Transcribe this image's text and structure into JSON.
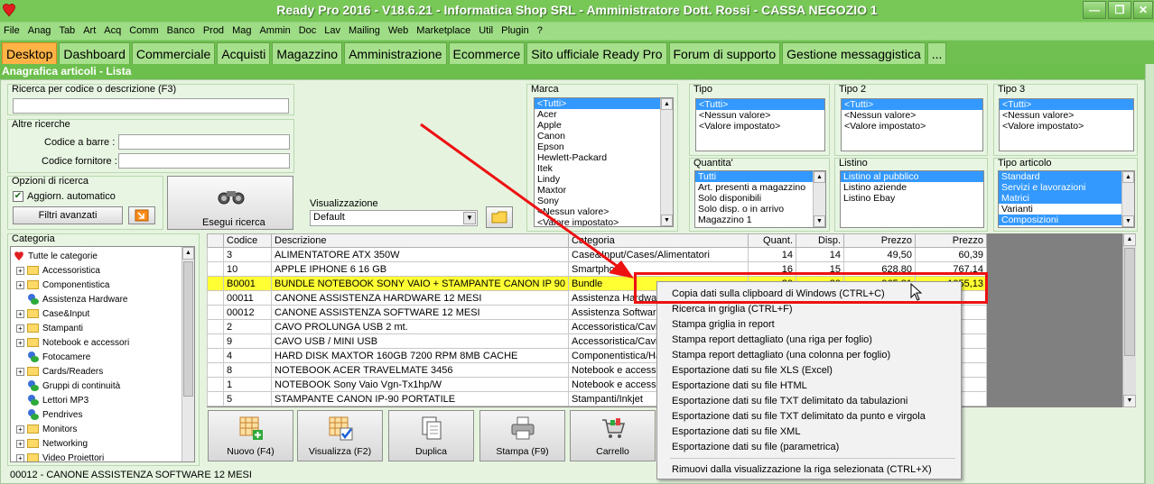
{
  "window": {
    "title": "Ready Pro 2016 - V18.6.21 - Informatica Shop SRL - Amministratore Dott. Rossi - CASSA NEGOZIO 1"
  },
  "menu": [
    "File",
    "Anag",
    "Tab",
    "Art",
    "Acq",
    "Comm",
    "Banco",
    "Prod",
    "Mag",
    "Ammin",
    "Doc",
    "Lav",
    "Mailing",
    "Web",
    "Marketplace",
    "Util",
    "Plugin",
    "?"
  ],
  "tabs": [
    "Desktop",
    "Dashboard",
    "Commerciale",
    "Acquisti",
    "Magazzino",
    "Amministrazione",
    "Ecommerce",
    "Sito ufficiale Ready Pro",
    "Forum di supporto",
    "Gestione messaggistica",
    "..."
  ],
  "section_title": "Anagrafica articoli  - Lista",
  "search": {
    "title": "Ricerca per codice o descrizione (F3)",
    "other_title": "Altre ricerche",
    "barcode_label": "Codice a barre :",
    "supplier_label": "Codice fornitore :",
    "options_title": "Opzioni di ricerca",
    "auto_update_label": "Aggiorn. automatico",
    "advanced_filters": "Filtri avanzati",
    "search_button": "Esegui ricerca",
    "view_label": "Visualizzazione",
    "view_value": "Default"
  },
  "filters": {
    "marca": {
      "title": "Marca",
      "items": [
        "<Tutti>",
        "Acer",
        "Apple",
        "Canon",
        "Epson",
        "Hewlett-Packard",
        "Itek",
        "Lindy",
        "Maxtor",
        "Sony",
        "<Nessun valore>",
        "<Valore impostato>"
      ]
    },
    "tipo": {
      "title": "Tipo",
      "items": [
        "<Tutti>",
        "<Nessun valore>",
        "<Valore impostato>"
      ]
    },
    "tipo2": {
      "title": "Tipo 2",
      "items": [
        "<Tutti>",
        "<Nessun valore>",
        "<Valore impostato>"
      ]
    },
    "tipo3": {
      "title": "Tipo 3",
      "items": [
        "<Tutti>",
        "<Nessun valore>",
        "<Valore impostato>"
      ]
    },
    "quantita": {
      "title": "Quantita'",
      "items": [
        "Tutti",
        "Art. presenti a magazzino",
        "Solo disponibili",
        "Solo disp. o in arrivo",
        "Magazzino 1"
      ]
    },
    "listino": {
      "title": "Listino",
      "items": [
        "Listino al pubblico",
        "Listino aziende",
        "Listino Ebay"
      ]
    },
    "tipo_articolo": {
      "title": "Tipo articolo",
      "items": [
        "Standard",
        "Servizi e lavorazioni",
        "Matrici",
        "Varianti",
        "Composizioni"
      ]
    }
  },
  "category": {
    "title": "Categoria",
    "root": "Tutte le categorie",
    "items": [
      "Accessoristica",
      "Componentistica",
      "Assistenza Hardware",
      "Case&Input",
      "Stampanti",
      "Notebook e accessori",
      "Fotocamere",
      "Cards/Readers",
      "Gruppi di continuità",
      "Lettori MP3",
      "Pendrives",
      "Monitors",
      "Networking",
      "Video Proiettori"
    ]
  },
  "grid": {
    "headers": [
      "Codice",
      "Descrizione",
      "Categoria",
      "Quant.",
      "Disp.",
      "Prezzo",
      "Prezzo"
    ],
    "rows": [
      [
        "3",
        "ALIMENTATORE ATX 350W",
        "Case&Input/Cases/Alimentatori",
        "14",
        "14",
        "49,50",
        "60,39"
      ],
      [
        "10",
        "APPLE IPHONE 6 16 GB",
        "Smartphone",
        "16",
        "15",
        "628,80",
        "767,14"
      ],
      [
        "B0001",
        "BUNDLE NOTEBOOK SONY VAIO + STAMPANTE CANON IP 90",
        "Bundle",
        "20",
        "20",
        "965,81",
        "1055,13"
      ],
      [
        "00011",
        "CANONE ASSISTENZA HARDWARE 12 MESI",
        "Assistenza Hardware",
        "",
        "",
        "",
        ""
      ],
      [
        "00012",
        "CANONE ASSISTENZA SOFTWARE 12 MESI",
        "Assistenza Software",
        "",
        "",
        "",
        ""
      ],
      [
        "2",
        "CAVO PROLUNGA USB 2 mt.",
        "Accessoristica/Cavi/USB",
        "",
        "",
        "",
        ""
      ],
      [
        "9",
        "CAVO USB / MINI USB",
        "Accessoristica/Cavi/USB",
        "",
        "",
        "",
        ""
      ],
      [
        "4",
        "HARD DISK MAXTOR 160GB 7200 RPM 8MB CACHE",
        "Componentistica/Hard-disk",
        "",
        "",
        "",
        ""
      ],
      [
        "8",
        "NOTEBOOK ACER TRAVELMATE 3456",
        "Notebook e accessori/Notebook",
        "",
        "",
        "",
        ""
      ],
      [
        "1",
        "NOTEBOOK Sony Vaio Vgn-Tx1hp/W",
        "Notebook e accessori/Notebook",
        "",
        "",
        "",
        ""
      ],
      [
        "5",
        "STAMPANTE CANON IP-90 PORTATILE",
        "Stampanti/Inkjet",
        "",
        "",
        "",
        ""
      ]
    ]
  },
  "actions": [
    "Nuovo (F4)",
    "Visualizza (F2)",
    "Duplica",
    "Stampa (F9)",
    "Carrello"
  ],
  "status": "00012 - CANONE ASSISTENZA SOFTWARE 12 MESI",
  "context_menu": [
    "Copia dati sulla clipboard di Windows (CTRL+C)",
    "Ricerca in griglia (CTRL+F)",
    "Stampa griglia in report",
    "Stampa report dettagliato (una riga per foglio)",
    "Stampa report dettagliato (una colonna per foglio)",
    "Esportazione dati su file XLS (Excel)",
    "Esportazione dati su file HTML",
    "Esportazione dati su file TXT delimitato da tabulazioni",
    "Esportazione dati su file TXT delimitato da punto e virgola",
    "Esportazione dati su file XML",
    "Esportazione dati su file (parametrica)",
    "Rimuovi dalla visualizzazione la riga selezionata (CTRL+X)"
  ],
  "colors": {
    "accent": "#ffb347",
    "highlight_row": "#ffff33",
    "selection": "#3399ff",
    "annotation": "#ee1111"
  }
}
